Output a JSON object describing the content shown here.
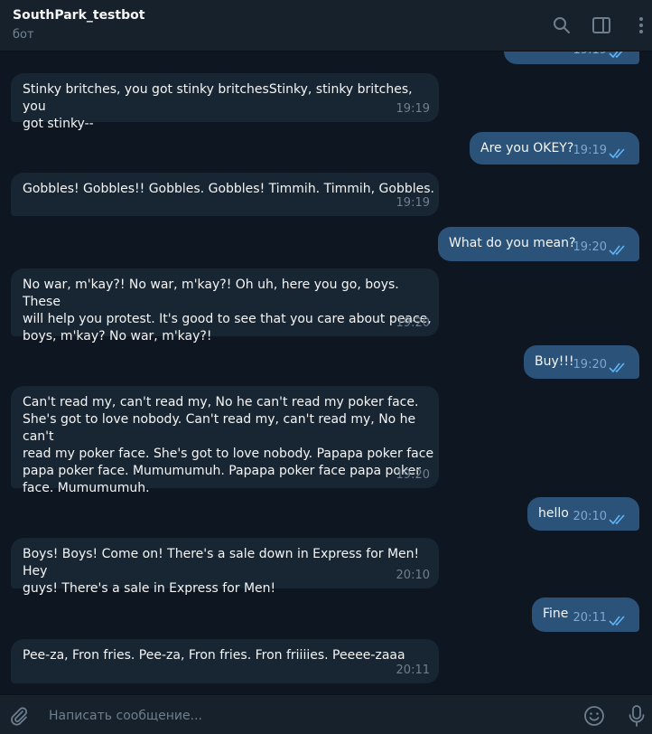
{
  "header": {
    "title": "SouthPark_testbot",
    "subtitle": "бот"
  },
  "messages": {
    "top_partial_time": "19:19",
    "m1": {
      "text": "Stinky britches, you got stinky britchesStinky, stinky britches, you\ngot stinky--",
      "time": "19:19"
    },
    "m2": {
      "text": "Are you OKEY?",
      "time": "19:19"
    },
    "m3": {
      "text": "Gobbles!  Gobbles!!  Gobbles. Gobbles!  Timmih.  Timmih, Gobbles.",
      "time": "19:19"
    },
    "m4": {
      "text": "What do you mean?",
      "time": "19:20"
    },
    "m5": {
      "text": "No war, m'kay?! No war, m'kay?! Oh uh, here you go, boys.  These\nwill help you protest. It's good to see that you care about peace,\nboys, m'kay? No war, m'kay?!",
      "time": "19:20"
    },
    "m6": {
      "text": "Buy!!!",
      "time": "19:20"
    },
    "m7": {
      "text": "Can't read my, can't read my, No he can't read my poker face.\nShe's got to love nobody. Can't read my, can't read my, No he can't\nread my poker face. She's got to love nobody. Papapa poker face\npapa poker face. Mumumumuh. Papapa poker face papa poker\nface. Mumumumuh.",
      "time": "19:20"
    },
    "m8": {
      "text": "hello",
      "time": "20:10"
    },
    "m9": {
      "text": "Boys! Boys! Come on! There's a sale down in Express for Men!  Hey\nguys! There's a sale in Express for Men!",
      "time": "20:10"
    },
    "m10": {
      "text": "Fine",
      "time": "20:11"
    },
    "m11": {
      "text": "Pee-za, Fron fries. Pee-za, Fron fries. Fron friiiies.  Peeee-zaaa",
      "time": "20:11"
    }
  },
  "composer": {
    "placeholder": "Написать сообщение..."
  },
  "icons": {
    "header": [
      "search-icon",
      "sidebar-toggle-icon",
      "more-icon"
    ],
    "composer": [
      "attach-icon",
      "emoji-icon",
      "microphone-icon"
    ],
    "read_receipt": "double-check-icon"
  },
  "colors": {
    "background": "#0e1621",
    "header": "#17212b",
    "incoming_bubble": "#182533",
    "outgoing_bubble": "#2b5278",
    "read_check": "#5eb5f7"
  }
}
